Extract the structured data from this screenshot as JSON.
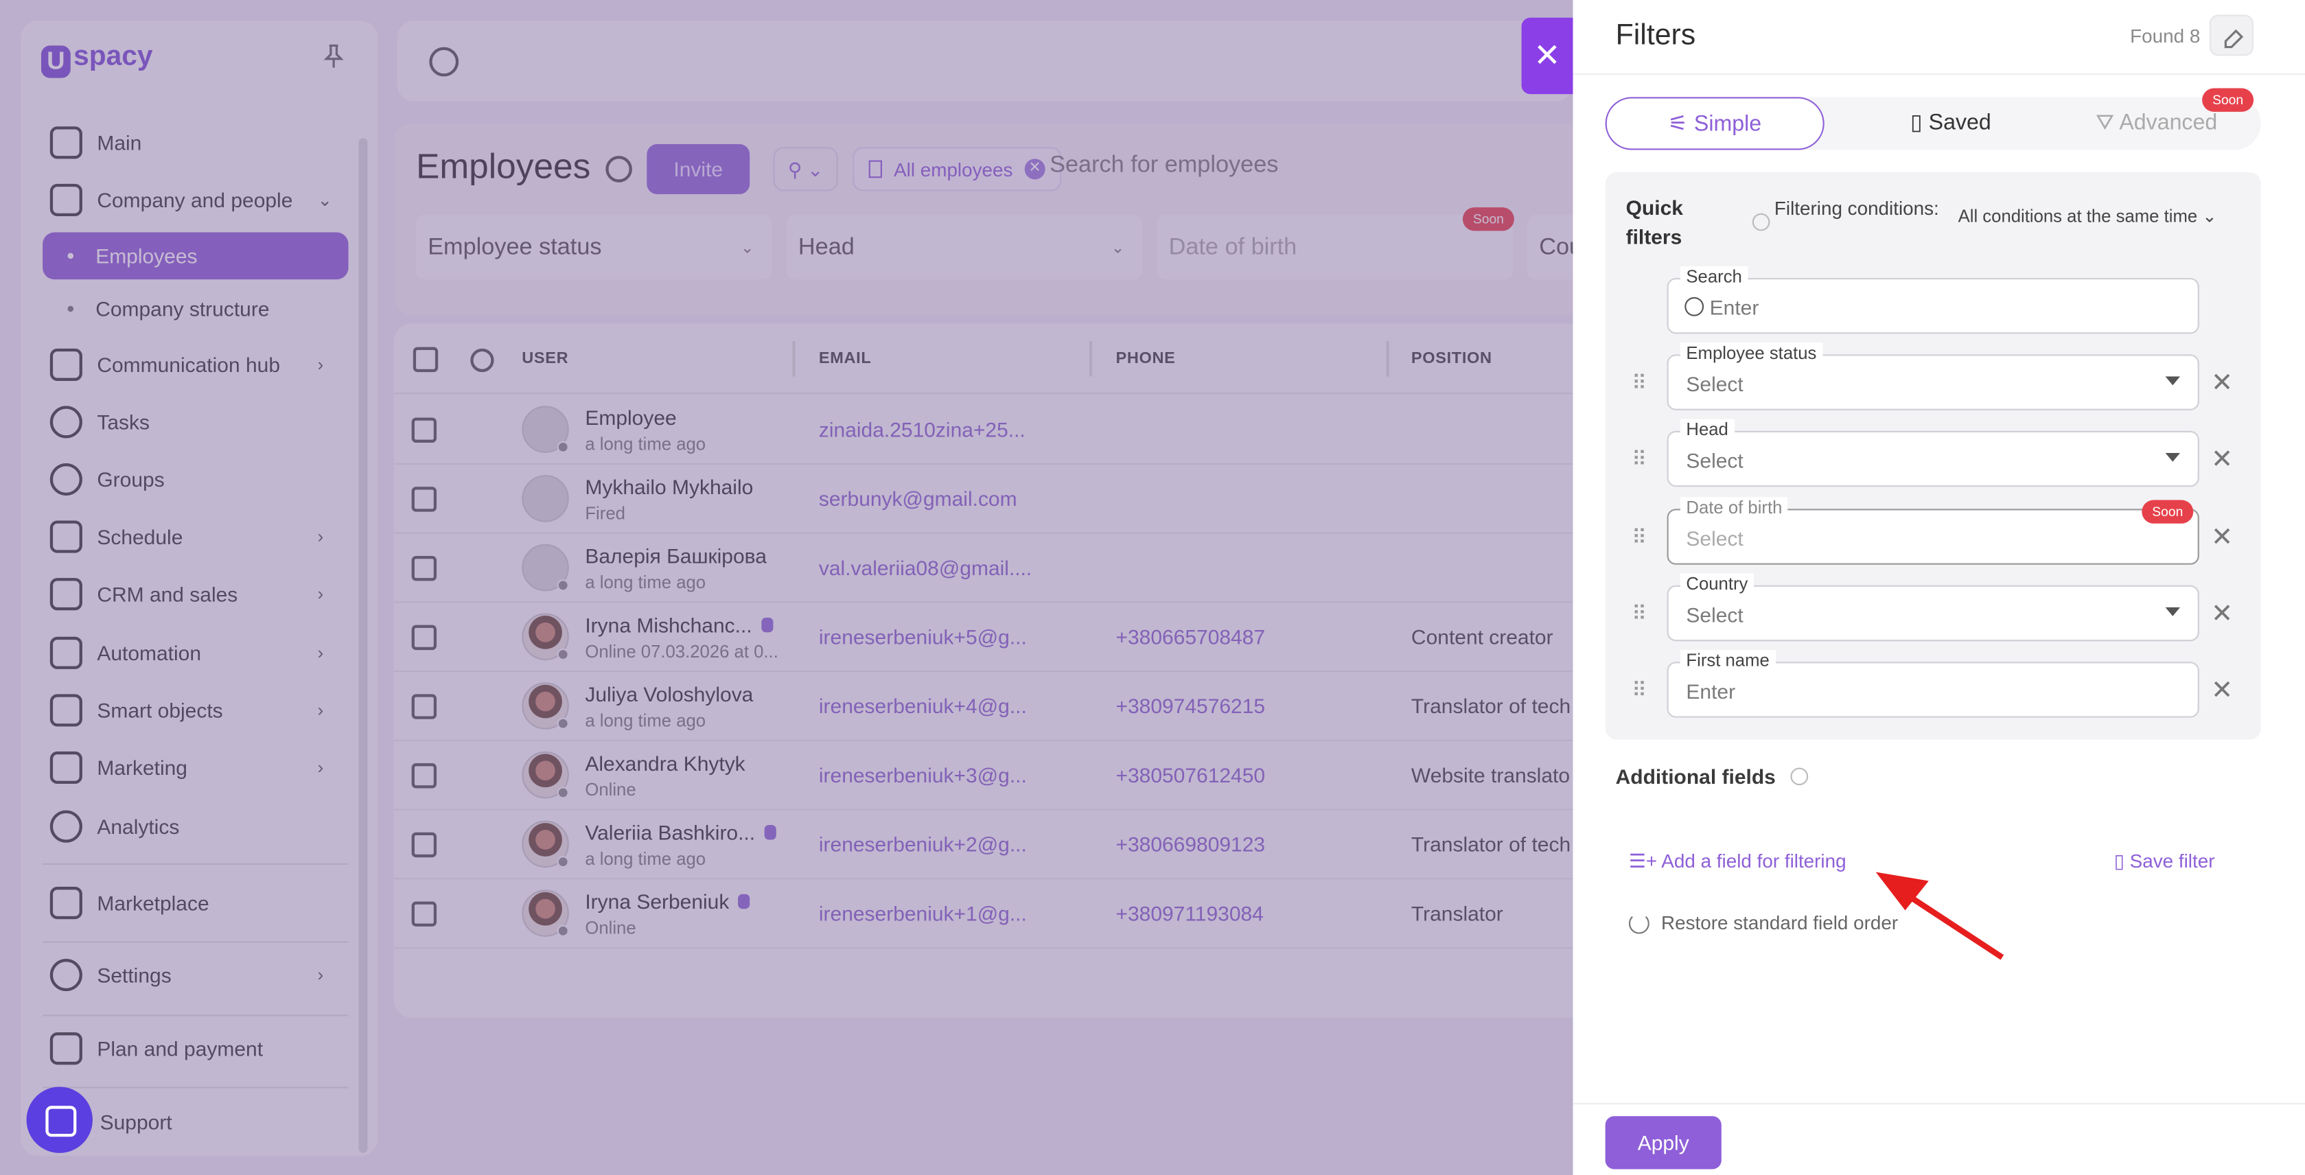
{
  "app": {
    "logo": "spacy",
    "logo_letter": "U"
  },
  "sidebar": {
    "items": [
      {
        "label": "Main"
      },
      {
        "label": "Company and people"
      },
      {
        "label": "Employees"
      },
      {
        "label": "Company structure"
      },
      {
        "label": "Communication hub"
      },
      {
        "label": "Tasks"
      },
      {
        "label": "Groups"
      },
      {
        "label": "Schedule"
      },
      {
        "label": "CRM and sales"
      },
      {
        "label": "Automation"
      },
      {
        "label": "Smart objects"
      },
      {
        "label": "Marketing"
      },
      {
        "label": "Analytics"
      },
      {
        "label": "Marketplace"
      },
      {
        "label": "Settings"
      },
      {
        "label": "Plan and payment"
      },
      {
        "label": "Support"
      }
    ]
  },
  "page": {
    "title": "Employees",
    "invite_label": "Invite",
    "chip_label": "All employees",
    "search_placeholder": "Search for employees",
    "filters": [
      "Employee status",
      "Head",
      "Date of birth",
      "Cou"
    ],
    "soon": "Soon"
  },
  "table": {
    "columns": [
      "USER",
      "EMAIL",
      "PHONE",
      "POSITION"
    ],
    "rows": [
      {
        "name": "Employee",
        "sub": "a long time ago",
        "email": "zinaida.2510zina+25...",
        "phone": "",
        "position": ""
      },
      {
        "name": "Mykhailo Mykhailo",
        "sub": "Fired",
        "email": "serbunyk@gmail.com",
        "phone": "",
        "position": ""
      },
      {
        "name": "Валерія Башкірова",
        "sub": "a long time ago",
        "email": "val.valeriia08@gmail....",
        "phone": "",
        "position": ""
      },
      {
        "name": "Iryna Mishchanc...",
        "sub": "Online 07.03.2026 at 0...",
        "email": "ireneserbeniuk+5@g...",
        "phone": "+380665708487",
        "position": "Content creator"
      },
      {
        "name": "Juliya Voloshylova",
        "sub": "a long time ago",
        "email": "ireneserbeniuk+4@g...",
        "phone": "+380974576215",
        "position": "Translator of tech"
      },
      {
        "name": "Alexandra Khytyk",
        "sub": "Online",
        "email": "ireneserbeniuk+3@g...",
        "phone": "+380507612450",
        "position": "Website translato"
      },
      {
        "name": "Valeriia Bashkiro...",
        "sub": "a long time ago",
        "email": "ireneserbeniuk+2@g...",
        "phone": "+380669809123",
        "position": "Translator of tech"
      },
      {
        "name": "Iryna Serbeniuk",
        "sub": "Online",
        "email": "ireneserbeniuk+1@g...",
        "phone": "+380971193084",
        "position": "Translator"
      }
    ]
  },
  "panel": {
    "title": "Filters",
    "found": "Found 8",
    "tabs": [
      "Simple",
      "Saved",
      "Advanced"
    ],
    "soon": "Soon",
    "quick_filters": "Quick filters",
    "filtering_conditions": "Filtering conditions:",
    "conditions_value": "All conditions at the same time",
    "fields": [
      {
        "label": "Search",
        "value": "Enter"
      },
      {
        "label": "Employee status",
        "value": "Select"
      },
      {
        "label": "Head",
        "value": "Select"
      },
      {
        "label": "Date of birth",
        "value": "Select"
      },
      {
        "label": "Country",
        "value": "Select"
      },
      {
        "label": "First name",
        "value": "Enter"
      }
    ],
    "additional_fields": "Additional fields",
    "add_field": "Add a field for filtering",
    "save_filter": "Save filter",
    "restore": "Restore standard field order",
    "apply": "Apply"
  }
}
